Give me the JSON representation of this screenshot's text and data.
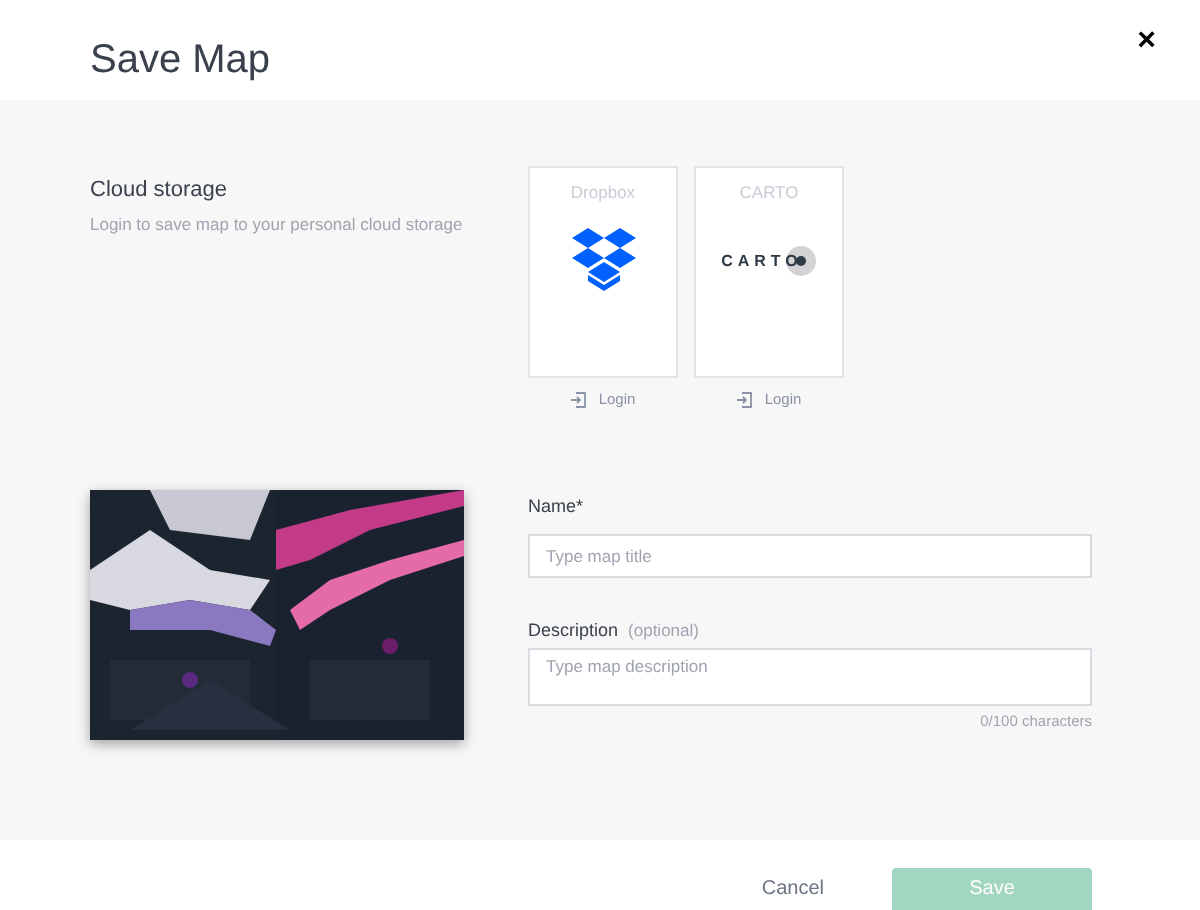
{
  "dialog": {
    "title": "Save Map",
    "close": "×"
  },
  "cloud_storage": {
    "title": "Cloud storage",
    "subtitle": "Login to save map to your personal cloud storage",
    "providers": [
      {
        "name": "Dropbox",
        "kind": "dropbox",
        "action": "Login"
      },
      {
        "name": "CARTO",
        "kind": "carto",
        "logo_text": "CARTO",
        "action": "Login"
      }
    ]
  },
  "form": {
    "name": {
      "label": "Name*",
      "placeholder": "Type map title"
    },
    "description": {
      "label": "Description",
      "hint": "(optional)",
      "placeholder": "Type map description",
      "counter": "0/100 characters"
    }
  },
  "footer": {
    "cancel": "Cancel",
    "save": {
      "label": "Save",
      "disabled": true
    }
  }
}
